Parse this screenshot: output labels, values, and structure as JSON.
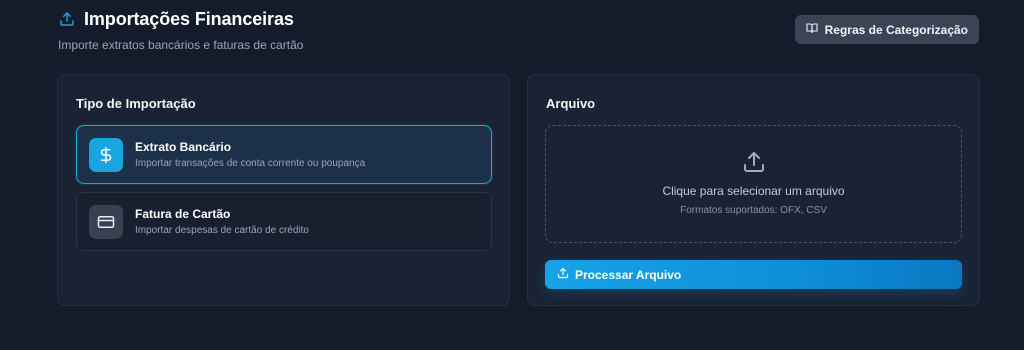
{
  "header": {
    "title": "Importações Financeiras",
    "subtitle": "Importe extratos bancários e faturas de cartão",
    "rules_button_label": "Regras de Categorização",
    "title_icon": "upload-icon",
    "rules_icon": "book-icon"
  },
  "import_type": {
    "title": "Tipo de Importação",
    "options": [
      {
        "title": "Extrato Bancário",
        "description": "Importar transações de conta corrente ou poupança",
        "icon": "dollar-icon",
        "selected": true
      },
      {
        "title": "Fatura de Cartão",
        "description": "Importar despesas de cartão de crédito",
        "icon": "credit-card-icon",
        "selected": false
      }
    ]
  },
  "file": {
    "title": "Arquivo",
    "dropzone_text": "Clique para selecionar um arquivo",
    "formats_text": "Formatos suportados: OFX, CSV",
    "process_button_label": "Processar Arquivo"
  },
  "colors": {
    "accent": "#1aa5e0",
    "background": "#141c2b",
    "card": "#1a2333"
  }
}
